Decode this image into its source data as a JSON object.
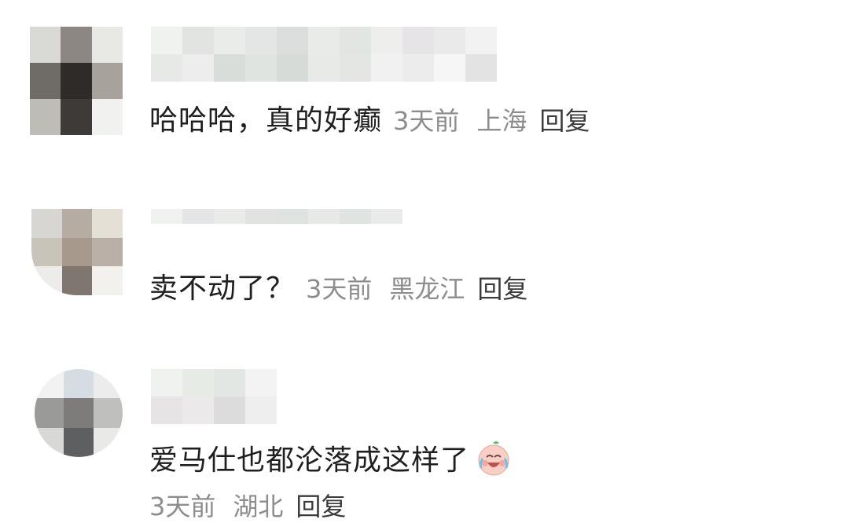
{
  "comments": [
    {
      "text": "哈哈哈，真的好癫",
      "time": "3天前",
      "location": "上海",
      "reply": "回复"
    },
    {
      "text": "卖不动了？",
      "time": "3天前",
      "location": "黑龙江",
      "reply": "回复"
    },
    {
      "text": "爱马仕也都沦落成这样了",
      "emoji": "crying-laughing-emoji",
      "time": "3天前",
      "location": "湖北",
      "reply": "回复"
    }
  ],
  "colors": {
    "text": "#1f1f1f",
    "meta": "#8d8d8d",
    "reply": "#3b3b3b"
  }
}
